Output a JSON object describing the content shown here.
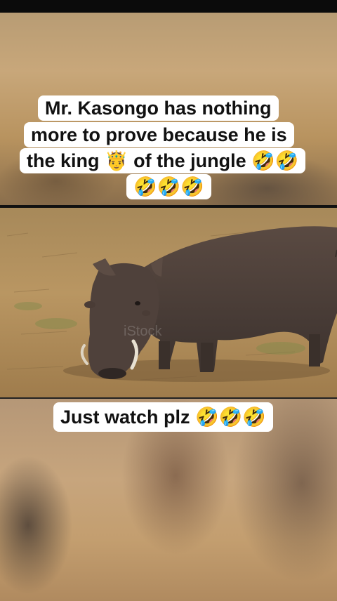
{
  "caption_top": {
    "line1": "Mr. Kasongo has nothing",
    "line2": "more to prove because he is",
    "line3": "the king 🤴 of the jungle 🤣🤣",
    "line4": "🤣🤣🤣"
  },
  "caption_bottom": {
    "text": "Just watch plz 🤣🤣🤣"
  },
  "watermark": "iStock",
  "colors": {
    "caption_bg": "#ffffff",
    "caption_text": "#111111",
    "warthog": "#4a3e38",
    "grass": "#b8955f"
  }
}
